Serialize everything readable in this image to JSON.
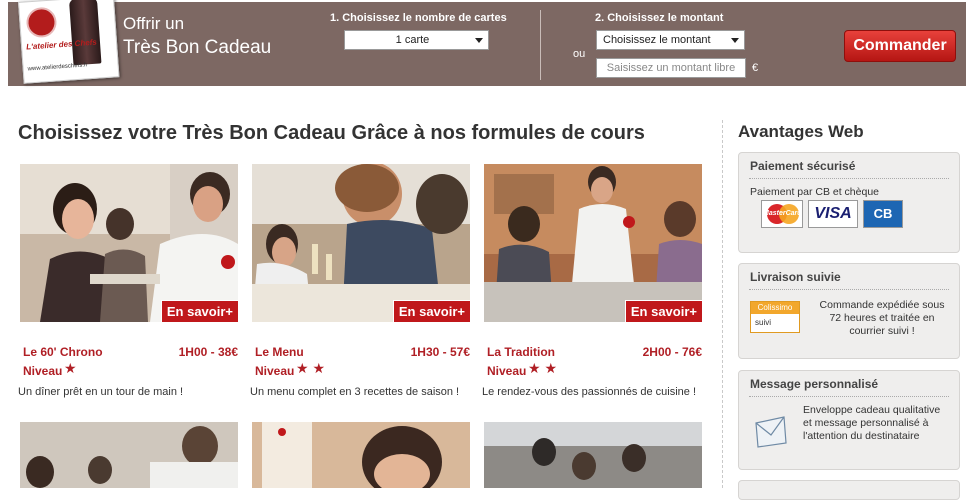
{
  "header": {
    "offer_line1": "Offrir un",
    "offer_line2": "Très Bon Cadeau",
    "step1_label": "1. Choisissez le nombre de cartes",
    "step1_value": "1 carte",
    "step2_label": "2. Choisissez le montant",
    "step2_value": "Choisissez le montant",
    "or_label": "ou",
    "free_amount_placeholder": "Saisissez un montant libre",
    "currency": "€",
    "order_button": "Commander"
  },
  "logo": {
    "name": "L'atelier des Chefs",
    "url": "www.atelierdeschefs.fr"
  },
  "main": {
    "title": "Choisissez votre Très Bon Cadeau Grâce à nos formules de cours",
    "more_label": "En savoir+",
    "level_label": "Niveau",
    "cards": [
      {
        "name": "Le 60' Chrono",
        "price": "1H00 - 38€",
        "stars": "★",
        "level": 1,
        "desc": "Un dîner prêt en un tour de main !"
      },
      {
        "name": "Le Menu",
        "price": "1H30 - 57€",
        "stars": "★★",
        "level": 2,
        "desc": "Un menu complet en 3 recettes de saison !"
      },
      {
        "name": "La Tradition",
        "price": "2H00 - 76€",
        "stars": "★★",
        "level": 2,
        "desc": "Le rendez-vous des passionnés de cuisine !"
      }
    ]
  },
  "sidebar": {
    "title": "Avantages Web",
    "payment": {
      "title": "Paiement sécurisé",
      "text": "Paiement par CB et chèque",
      "cards": [
        "MasterCard",
        "VISA",
        "CB"
      ]
    },
    "delivery": {
      "title": "Livraison suivie",
      "badge_top": "Colissimo",
      "badge_bottom": "suivi",
      "text_lines": [
        "Commande expédiée sous",
        "72 heures et traitée en",
        "courrier suivi !"
      ]
    },
    "message": {
      "title": "Message personnalisé",
      "text_lines": [
        "Enveloppe cadeau qualitative",
        "et message personnalisé à",
        "l'attention du destinataire"
      ]
    }
  },
  "colors": {
    "header_bg": "#7d6863",
    "accent_red": "#c0181b",
    "text_red": "#b01f25"
  }
}
